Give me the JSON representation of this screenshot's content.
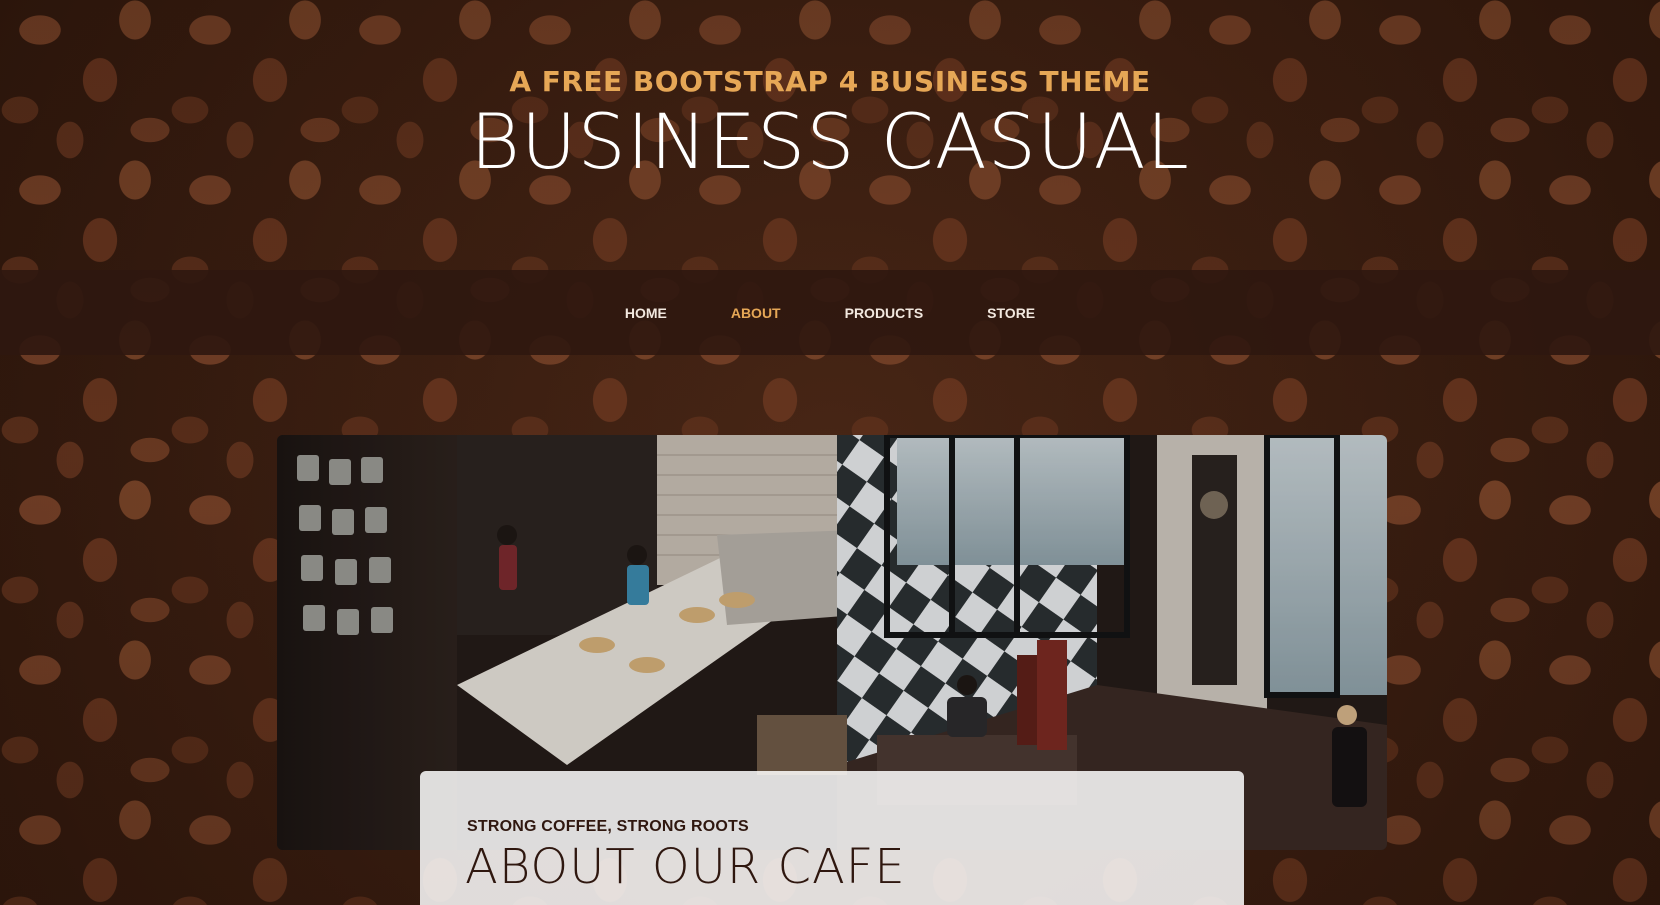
{
  "site": {
    "heading_upper": "A FREE BOOTSTRAP 4 BUSINESS THEME",
    "heading_lower": "BUSINESS CASUAL"
  },
  "nav": {
    "items": [
      {
        "label": "HOME",
        "active": false
      },
      {
        "label": "ABOUT",
        "active": true
      },
      {
        "label": "PRODUCTS",
        "active": false
      },
      {
        "label": "STORE",
        "active": false
      }
    ]
  },
  "intro": {
    "subheading": "STRONG COFFEE, STRONG ROOTS",
    "heading": "ABOUT OUR CAFE"
  },
  "colors": {
    "accent": "#e6a756",
    "nav_background": "#2f170f",
    "text_dark": "#2f170f",
    "text_light": "#ffffff"
  },
  "icons": {
    "background": "coffee-beans-background",
    "intro_image": "cafe-interior-photo"
  }
}
